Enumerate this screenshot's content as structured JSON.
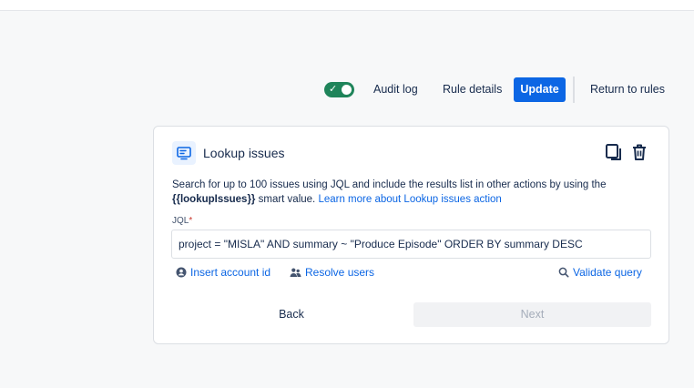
{
  "toolbar": {
    "toggle_on": true,
    "audit_log": "Audit log",
    "rule_details": "Rule details",
    "update": "Update",
    "return_to_rules": "Return to rules"
  },
  "card": {
    "icon": "monitor-icon",
    "title": "Lookup issues",
    "description": {
      "text_before": "Search for up to 100 issues using JQL and include the results list in other actions by using the",
      "smart_value": "{{lookupIssues}}",
      "text_after": "smart value.",
      "link": "Learn more about Lookup issues action"
    },
    "jql_label": "JQL",
    "required_marker": "*",
    "jql_value": "project = \"MISLA\" AND summary ~ \"Produce Episode\" ORDER BY summary DESC",
    "links": {
      "insert_account_id": "Insert account id",
      "resolve_users": "Resolve users",
      "validate_query": "Validate query"
    },
    "back": "Back",
    "next": "Next"
  },
  "colors": {
    "accent": "#0c66e4",
    "toggle": "#1f845a",
    "required": "#c9372c"
  }
}
